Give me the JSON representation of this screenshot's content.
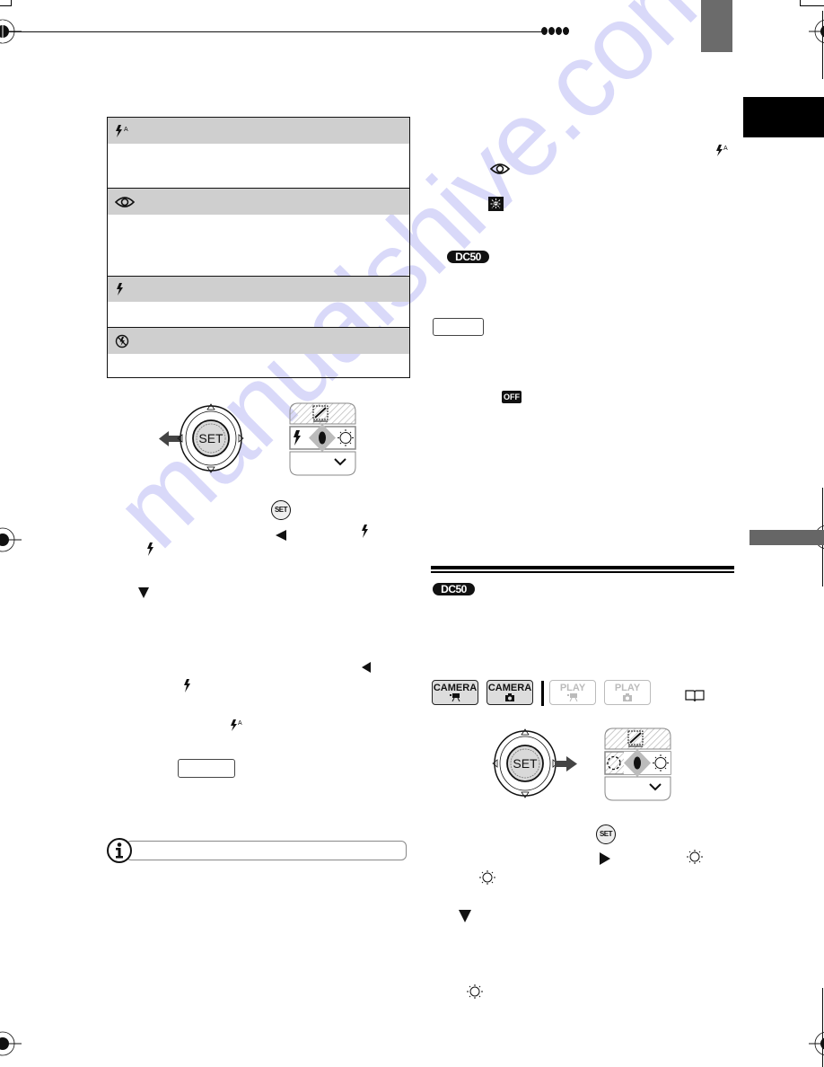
{
  "page": {
    "kind": "camcorder manual page (text stripped)",
    "watermark": "manualshive.com",
    "colors": {
      "table_header_bg": "#cfcfcf",
      "side_tab_gray": "#6b6b6b",
      "side_tab_black": "#000000",
      "watermark": "#7878eb",
      "dial_fill": "#d9d9d9"
    }
  },
  "flash_table": {
    "rows": [
      {
        "icon": "flash-auto-icon",
        "icon_text": "A"
      },
      {
        "icon": "red-eye-reduction-icon"
      },
      {
        "icon": "flash-on-icon"
      },
      {
        "icon": "flash-off-icon"
      }
    ]
  },
  "left_dial": {
    "button_label": "SET",
    "direction": "left",
    "panel_items": [
      "flash-icon",
      "joystick-center-icon",
      "sun-icon"
    ]
  },
  "right_dial": {
    "button_label": "SET",
    "direction": "right",
    "panel_items": [
      "dashed-circle-icon",
      "joystick-center-icon",
      "sun-icon"
    ]
  },
  "inline": {
    "set_label": "SET",
    "flash_auto_suffix": "A",
    "dc50_label": "DC50",
    "off_label": "OFF"
  },
  "mode_buttons": [
    {
      "label": "CAMERA",
      "sub": "movie-camera-icon",
      "active": true
    },
    {
      "label": "CAMERA",
      "sub": "still-camera-icon",
      "active": true
    },
    {
      "label": "PLAY",
      "sub": "movie-camera-icon",
      "active": false
    },
    {
      "label": "PLAY",
      "sub": "still-camera-icon",
      "active": false
    }
  ]
}
